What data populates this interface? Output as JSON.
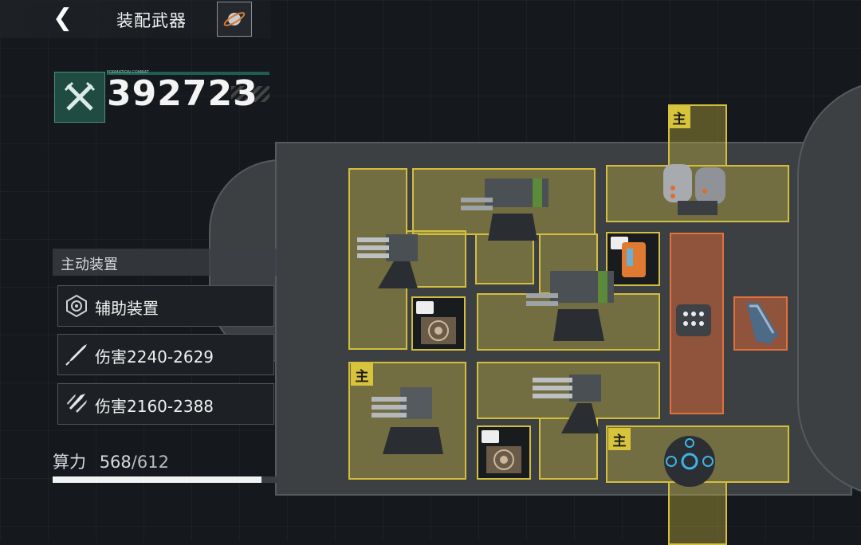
{
  "header": {
    "title": "装配武器"
  },
  "power": {
    "label": "FORMATION COMBAT",
    "value": "392723"
  },
  "panel": {
    "heading": "主动装置",
    "slots": [
      {
        "label": "辅助装置",
        "icon": "radar-icon"
      },
      {
        "label": "伤害2240-2629",
        "icon": "missile-icon"
      },
      {
        "label": "伤害2160-2388",
        "icon": "multi-missile-icon"
      }
    ]
  },
  "compute": {
    "label": "算力",
    "used": "568",
    "max": "/612",
    "ratio": 0.928
  },
  "badges": {
    "main": "主"
  },
  "colors": {
    "slot_yellow": "#d3be3e",
    "slot_orange": "#e0723f",
    "power_green": "#1f4b41"
  }
}
